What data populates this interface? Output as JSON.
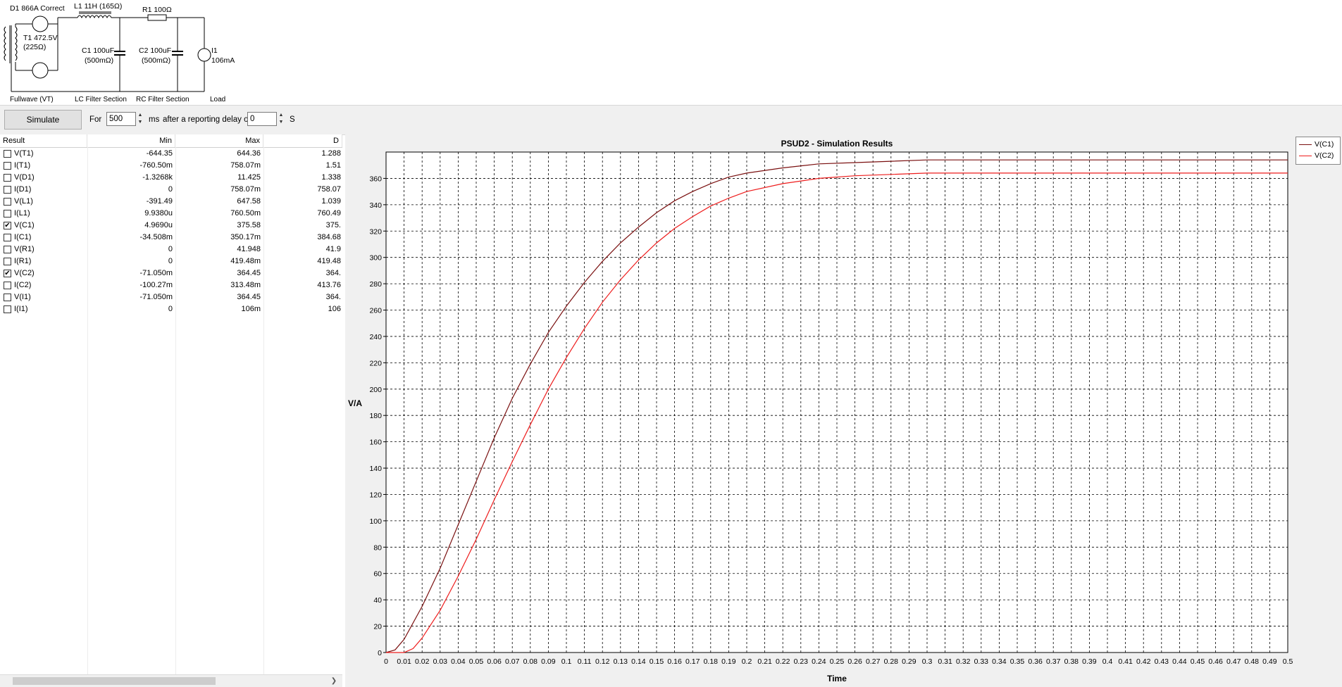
{
  "schematic": {
    "labels": {
      "d1": "D1 866A Correct",
      "l1": "L1 11H (165Ω)",
      "r1": "R1 100Ω",
      "t1a": "T1 472.5V",
      "t1b": "(225Ω)",
      "c1a": "C1 100uF",
      "c1b": "(500mΩ)",
      "c2a": "C2 100uF",
      "c2b": "(500mΩ)",
      "i1a": "I1",
      "i1b": "106mA",
      "sec_rect": "Fullwave (VT)",
      "sec_lc": "LC Filter Section",
      "sec_rc": "RC Filter Section",
      "sec_load": "Load"
    }
  },
  "toolbar": {
    "simulate_label": "Simulate",
    "for_label": "For",
    "duration_value": "500",
    "ms_label": "ms",
    "delay_label": "after a reporting delay of",
    "delay_value": "0",
    "s_label": "S"
  },
  "results": {
    "columns": [
      "Result",
      "Min",
      "Max",
      "D"
    ],
    "rows": [
      {
        "name": "V(T1)",
        "min": "-644.35",
        "max": "644.36",
        "d": "1.288",
        "checked": false
      },
      {
        "name": "I(T1)",
        "min": "-760.50m",
        "max": "758.07m",
        "d": "1.51",
        "checked": false
      },
      {
        "name": "V(D1)",
        "min": "-1.3268k",
        "max": "11.425",
        "d": "1.338",
        "checked": false
      },
      {
        "name": "I(D1)",
        "min": "0",
        "max": "758.07m",
        "d": "758.07",
        "checked": false
      },
      {
        "name": "V(L1)",
        "min": "-391.49",
        "max": "647.58",
        "d": "1.039",
        "checked": false
      },
      {
        "name": "I(L1)",
        "min": "9.9380u",
        "max": "760.50m",
        "d": "760.49",
        "checked": false
      },
      {
        "name": "V(C1)",
        "min": "4.9690u",
        "max": "375.58",
        "d": "375.",
        "checked": true
      },
      {
        "name": "I(C1)",
        "min": "-34.508m",
        "max": "350.17m",
        "d": "384.68",
        "checked": false
      },
      {
        "name": "V(R1)",
        "min": "0",
        "max": "41.948",
        "d": "41.9",
        "checked": false
      },
      {
        "name": "I(R1)",
        "min": "0",
        "max": "419.48m",
        "d": "419.48",
        "checked": false
      },
      {
        "name": "V(C2)",
        "min": "-71.050m",
        "max": "364.45",
        "d": "364.",
        "checked": true
      },
      {
        "name": "I(C2)",
        "min": "-100.27m",
        "max": "313.48m",
        "d": "413.76",
        "checked": false
      },
      {
        "name": "V(I1)",
        "min": "-71.050m",
        "max": "364.45",
        "d": "364.",
        "checked": false
      },
      {
        "name": "I(I1)",
        "min": "0",
        "max": "106m",
        "d": "106",
        "checked": false
      }
    ]
  },
  "colors": {
    "vc1": "#7a1010",
    "vc2": "#ee1c1c",
    "grid": "#000000"
  },
  "chart_data": {
    "type": "line",
    "title": "PSUD2 - Simulation Results",
    "xlabel": "Time",
    "ylabel": "V/A",
    "xlim": [
      0,
      0.5
    ],
    "ylim": [
      0,
      380
    ],
    "xticks": [
      "0",
      "0.01",
      "0.02",
      "0.03",
      "0.04",
      "0.05",
      "0.06",
      "0.07",
      "0.08",
      "0.09",
      "0.1",
      "0.11",
      "0.12",
      "0.13",
      "0.14",
      "0.15",
      "0.16",
      "0.17",
      "0.18",
      "0.19",
      "0.2",
      "0.21",
      "0.22",
      "0.23",
      "0.24",
      "0.25",
      "0.26",
      "0.27",
      "0.28",
      "0.29",
      "0.3",
      "0.31",
      "0.32",
      "0.33",
      "0.34",
      "0.35",
      "0.36",
      "0.37",
      "0.38",
      "0.39",
      "0.4",
      "0.41",
      "0.42",
      "0.43",
      "0.44",
      "0.45",
      "0.46",
      "0.47",
      "0.48",
      "0.49",
      "0.5"
    ],
    "yticks": [
      "0",
      "20",
      "40",
      "60",
      "80",
      "100",
      "120",
      "140",
      "160",
      "180",
      "200",
      "220",
      "240",
      "260",
      "280",
      "300",
      "320",
      "340",
      "360"
    ],
    "grid": true,
    "legend": "top-right",
    "series": [
      {
        "name": "V(C1)",
        "x": [
          0,
          0.005,
          0.01,
          0.02,
          0.03,
          0.04,
          0.05,
          0.06,
          0.07,
          0.08,
          0.09,
          0.1,
          0.11,
          0.12,
          0.13,
          0.14,
          0.15,
          0.16,
          0.17,
          0.18,
          0.19,
          0.2,
          0.22,
          0.24,
          0.26,
          0.28,
          0.3,
          0.35,
          0.4,
          0.45,
          0.5
        ],
        "y": [
          0,
          2,
          10,
          35,
          64,
          97,
          130,
          163,
          193,
          219,
          243,
          263,
          281,
          297,
          311,
          323,
          334,
          343,
          350,
          356,
          361,
          364,
          368,
          371,
          372,
          373,
          374,
          374,
          374,
          374,
          374
        ]
      },
      {
        "name": "V(C2)",
        "x": [
          0,
          0.01,
          0.015,
          0.02,
          0.03,
          0.04,
          0.05,
          0.06,
          0.07,
          0.08,
          0.09,
          0.1,
          0.11,
          0.12,
          0.13,
          0.14,
          0.15,
          0.16,
          0.17,
          0.18,
          0.19,
          0.2,
          0.22,
          0.24,
          0.26,
          0.28,
          0.3,
          0.35,
          0.4,
          0.45,
          0.5
        ],
        "y": [
          0,
          0,
          3,
          11,
          32,
          58,
          86,
          116,
          145,
          173,
          200,
          224,
          246,
          266,
          283,
          298,
          311,
          322,
          331,
          339,
          345,
          350,
          356,
          360,
          362,
          363,
          364,
          364,
          364,
          364,
          364
        ]
      }
    ]
  },
  "icons": {
    "checkbox_checked": "✔",
    "spin_up": "▲",
    "spin_down": "▼",
    "scroll_right": "❯"
  }
}
